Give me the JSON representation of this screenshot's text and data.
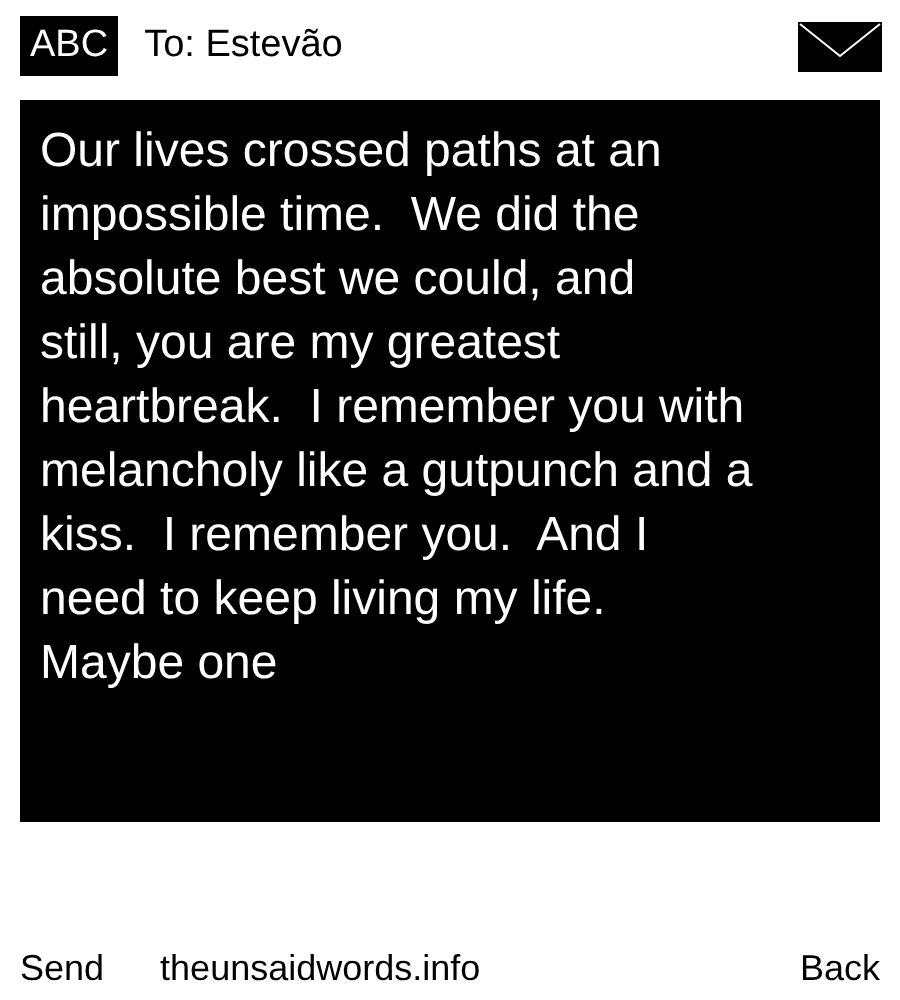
{
  "header": {
    "input_mode": "ABC",
    "recipient": "To: Estevão"
  },
  "message": {
    "text": "Our lives crossed paths at an\nimpossible time.  We did the\nabsolute best we could, and\nstill, you are my greatest\nheartbreak.  I remember you with\nmelancholy like a gutpunch and a\nkiss.  I remember you.  And I\nneed to keep living my life.\nMaybe one"
  },
  "footer": {
    "left": "Send",
    "center": "theunsaidwords.info",
    "right": "Back"
  }
}
